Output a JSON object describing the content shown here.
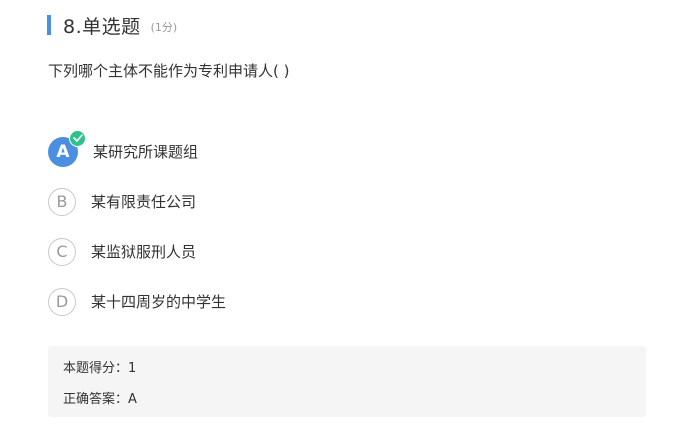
{
  "question": {
    "title": "8.单选题",
    "score": "(1分)",
    "text": "下列哪个主体不能作为专利申请人( )"
  },
  "options": [
    {
      "letter": "A",
      "text": "某研究所课题组",
      "selected": true
    },
    {
      "letter": "B",
      "text": "某有限责任公司",
      "selected": false
    },
    {
      "letter": "C",
      "text": "某监狱服刑人员",
      "selected": false
    },
    {
      "letter": "D",
      "text": "某十四周岁的中学生",
      "selected": false
    }
  ],
  "result": {
    "score_label": "本题得分：",
    "score_value": "1",
    "answer_label": "正确答案：",
    "answer_value": "A"
  },
  "colors": {
    "accent": "#4a8fe2",
    "check": "#2ec28b",
    "answer_bg": "#f5f5f5"
  },
  "icons": {
    "check": "check-icon"
  }
}
